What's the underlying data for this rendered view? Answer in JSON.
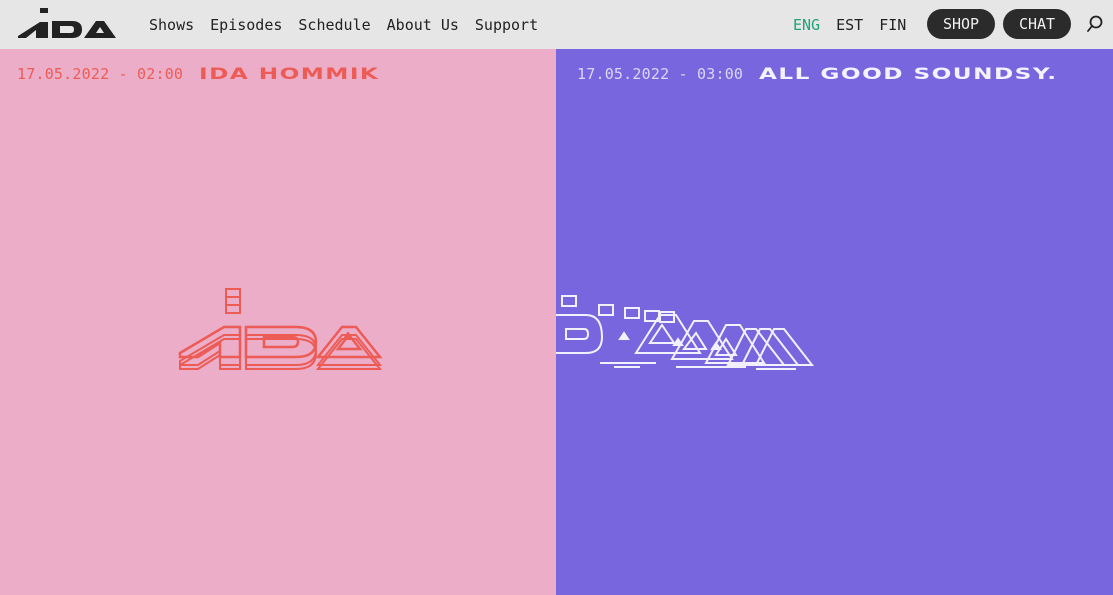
{
  "header": {
    "logo_text": "IDA",
    "nav": [
      "Shows",
      "Episodes",
      "Schedule",
      "About Us",
      "Support"
    ],
    "languages": [
      {
        "label": "ENG",
        "active": true
      },
      {
        "label": "EST",
        "active": false
      },
      {
        "label": "FIN",
        "active": false
      }
    ],
    "shop_label": "SHOP",
    "chat_label": "CHAT",
    "search_icon": "search-icon"
  },
  "panels": [
    {
      "datetime": "17.05.2022 - 02:00",
      "show": "IDA HOMMIK",
      "background": "#ecadc9",
      "accent": "#ec5c55",
      "art_text": "IDA"
    },
    {
      "datetime": "17.05.2022 - 03:00",
      "show": "ALL GOOD SOUNDSY.",
      "background": "#7766dd",
      "accent": "#f5f2ff",
      "art_text": "IDA"
    }
  ],
  "colors": {
    "header_bg": "#e6e6e6",
    "active_lang": "#1fa37a",
    "pill_bg": "#2b2b2b"
  }
}
